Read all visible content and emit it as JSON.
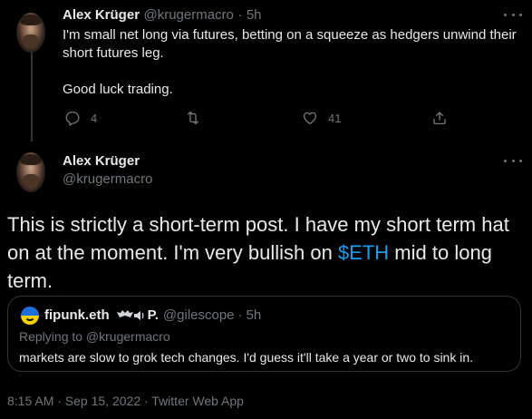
{
  "reply_tweet": {
    "display_name": "Alex Krüger",
    "handle": "@krugermacro",
    "separator": "·",
    "time": "5h",
    "text_line1": "I'm small net long via futures, betting on a squeeze as hedgers unwind their",
    "text_line2": "short futures leg.",
    "text_line3": "Good luck trading.",
    "reply_count": "4",
    "retweet_count": "",
    "like_count": "41",
    "icons": [
      "reply-icon",
      "retweet-icon",
      "like-icon",
      "share-icon",
      "more-icon"
    ]
  },
  "main_tweet": {
    "display_name": "Alex Krüger",
    "handle": "@krugermacro",
    "text_before": "This is strictly a short-term post. I have my short term hat on at the moment. I'm very bullish on ",
    "cashtag": "$ETH",
    "text_after": " mid to long term.",
    "meta": "8:15 AM · Sep 15, 2022 · Twitter Web App"
  },
  "quoted_tweet": {
    "display_name": "fipunk.eth",
    "name_suffix": "P.",
    "handle": "@gilescope",
    "separator": "·",
    "time": "5h",
    "replying_to": "Replying to @krugermacro",
    "text": "markets are slow to grok tech changes. I'd guess it'll take a year or two to sink in."
  },
  "colors": {
    "background": "#000000",
    "text": "#e7e9ea",
    "muted": "#71767b",
    "accent": "#1d9bf0",
    "border": "#2f3336"
  }
}
